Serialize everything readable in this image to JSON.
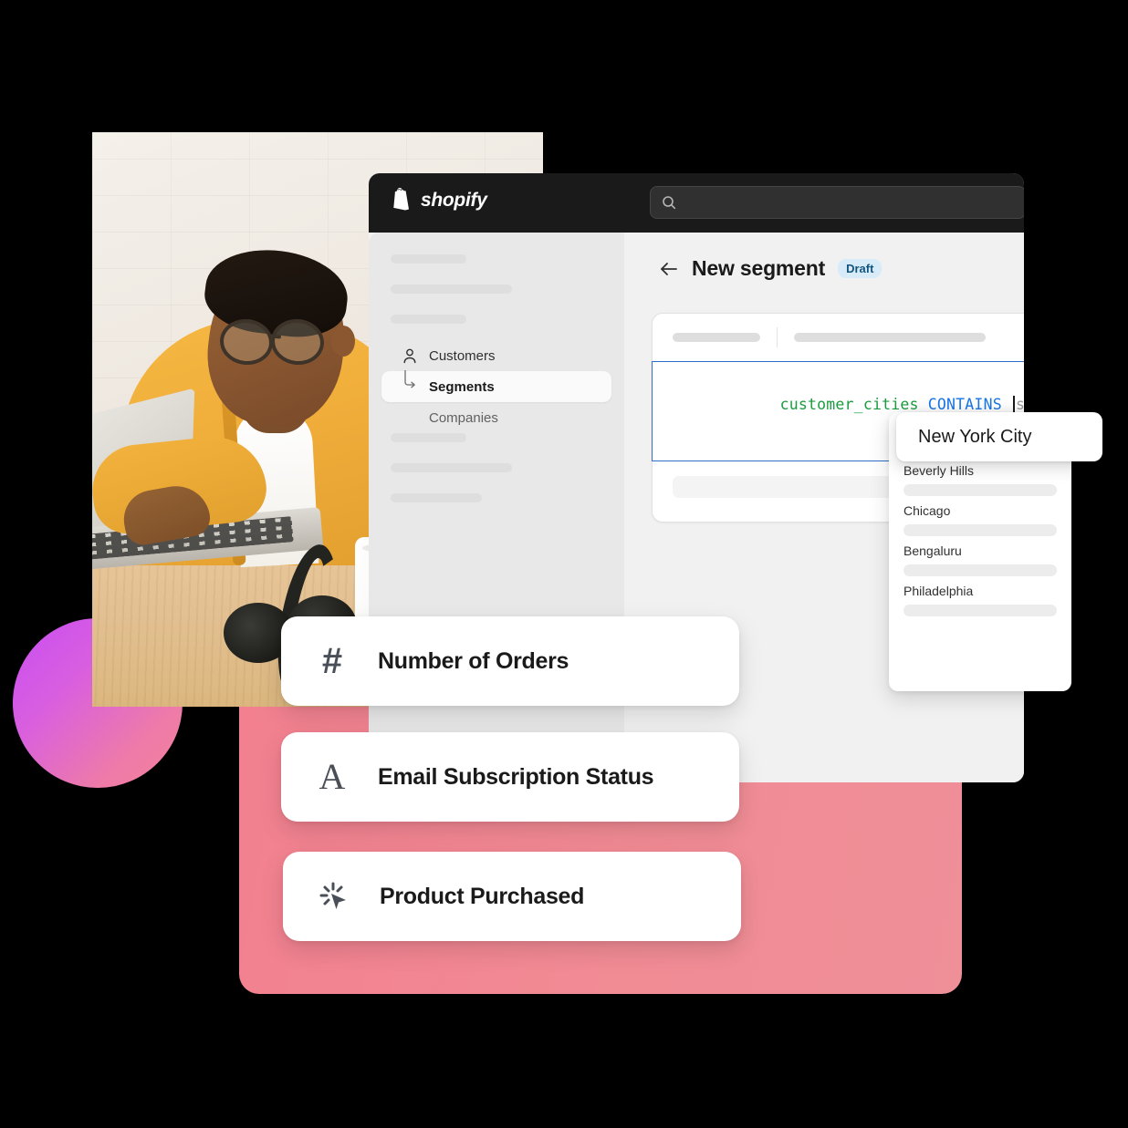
{
  "window": {
    "brand": "shopify",
    "search": {
      "value": "",
      "placeholder": ""
    }
  },
  "sidebar": {
    "items": [
      {
        "label": "Customers",
        "icon": "person-icon",
        "state": "normal"
      },
      {
        "label": "Segments",
        "icon": "corner-arrow-icon",
        "state": "active"
      },
      {
        "label": "Companies",
        "icon": "",
        "state": "muted"
      }
    ]
  },
  "main": {
    "back_label": "←",
    "title": "New segment",
    "status_badge": "Draft",
    "query": {
      "field": "customer_cities",
      "operator": "CONTAINS",
      "value_placeholder": "search city"
    }
  },
  "dropdown": {
    "selected": "New York City",
    "options": [
      "Beverly Hills",
      "Chicago",
      "Bengaluru",
      "Philadelphia"
    ]
  },
  "attribute_cards": [
    {
      "icon": "hash-icon",
      "label": "Number of Orders"
    },
    {
      "icon": "letter-a-icon",
      "label": "Email Subscription Status"
    },
    {
      "icon": "cursor-click-icon",
      "label": "Product Purchased"
    }
  ],
  "colors": {
    "accent_pink": "#f2808f",
    "accent_purple": "#c94ef2",
    "badge_bg": "#d7ecf8",
    "badge_text": "#14557f",
    "code_field": "#1a9c3f",
    "code_operator": "#1877e8",
    "editor_border": "#2f6ecb",
    "topbar": "#1a1a1a"
  }
}
